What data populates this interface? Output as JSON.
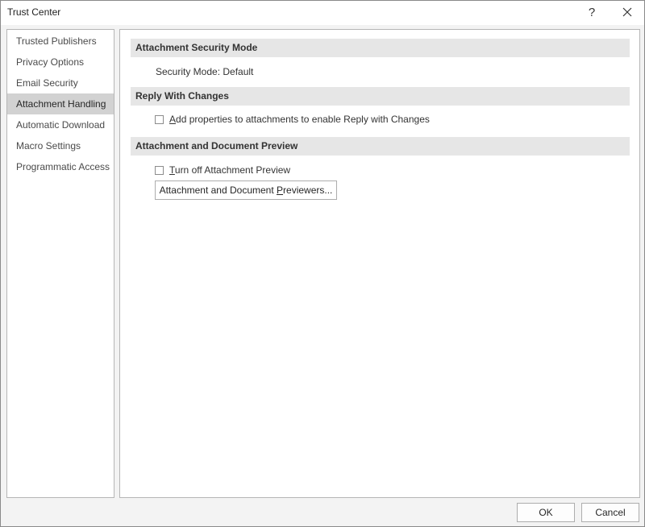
{
  "window": {
    "title": "Trust Center",
    "help_glyph": "?",
    "help_icon": "question-mark-icon",
    "close_icon": "close-x-icon"
  },
  "sidebar": {
    "selected_index": 3,
    "items": [
      {
        "label": "Trusted Publishers"
      },
      {
        "label": "Privacy Options"
      },
      {
        "label": "Email Security"
      },
      {
        "label": "Attachment Handling"
      },
      {
        "label": "Automatic Download"
      },
      {
        "label": "Macro Settings"
      },
      {
        "label": "Programmatic Access"
      }
    ]
  },
  "main": {
    "security_mode": {
      "header": "Attachment Security Mode",
      "text": "Security Mode: Default"
    },
    "reply_with_changes": {
      "header": "Reply With Changes",
      "checkbox_mnemonic": "A",
      "checkbox_rest": "dd properties to attachments to enable Reply with Changes",
      "checked": false
    },
    "preview": {
      "header": "Attachment and Document Preview",
      "checkbox_mnemonic": "T",
      "checkbox_rest": "urn off Attachment Preview",
      "checked": false,
      "button_pre": "Attachment and Document ",
      "button_mnemonic": "P",
      "button_post": "reviewers..."
    }
  },
  "footer": {
    "ok_label": "OK",
    "cancel_label": "Cancel"
  },
  "colors": {
    "selected_item_bg": "#d2d2d2",
    "section_header_bg": "#e6e6e6",
    "window_bg": "#f3f3f3"
  }
}
